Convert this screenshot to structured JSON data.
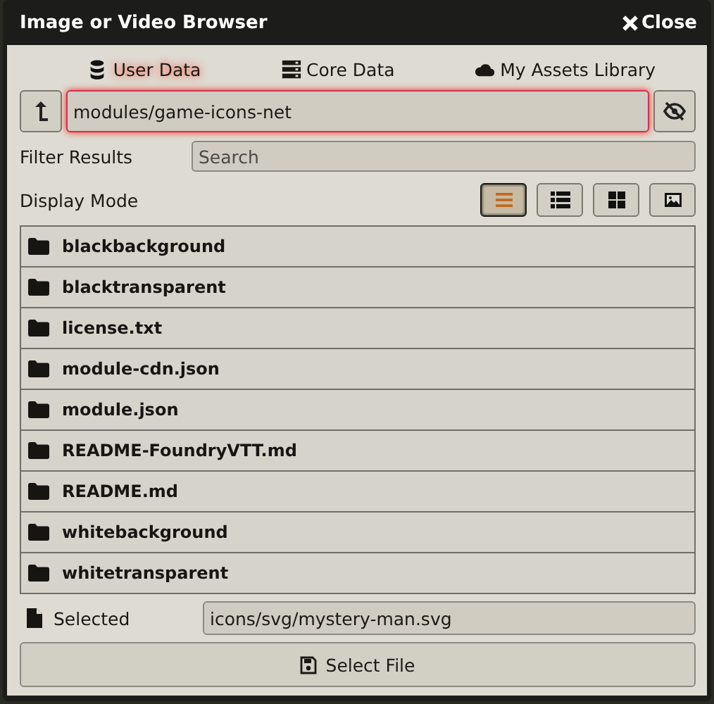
{
  "window": {
    "title": "Image or Video Browser",
    "close_label": "Close"
  },
  "tabs": [
    {
      "label": "User Data",
      "kind": "database",
      "selected": true
    },
    {
      "label": "Core Data",
      "kind": "server",
      "selected": false
    },
    {
      "label": "My Assets Library",
      "kind": "cloud",
      "selected": false
    }
  ],
  "path": {
    "value": "modules/game-icons-net",
    "focused": true
  },
  "filter": {
    "label": "Filter Results",
    "placeholder": "Search"
  },
  "display_mode": {
    "label": "Display Mode",
    "modes": [
      {
        "kind": "list",
        "selected": true
      },
      {
        "kind": "details",
        "selected": false
      },
      {
        "kind": "tiles",
        "selected": false
      },
      {
        "kind": "images",
        "selected": false
      }
    ]
  },
  "files": [
    {
      "name": "blackbackground"
    },
    {
      "name": "blacktransparent"
    },
    {
      "name": "license.txt"
    },
    {
      "name": "module-cdn.json"
    },
    {
      "name": "module.json"
    },
    {
      "name": "README-FoundryVTT.md"
    },
    {
      "name": "README.md"
    },
    {
      "name": "whitebackground"
    },
    {
      "name": "whitetransparent"
    }
  ],
  "selected": {
    "label": "Selected",
    "value": "icons/svg/mystery-man.svg"
  },
  "select_button": "Select File"
}
